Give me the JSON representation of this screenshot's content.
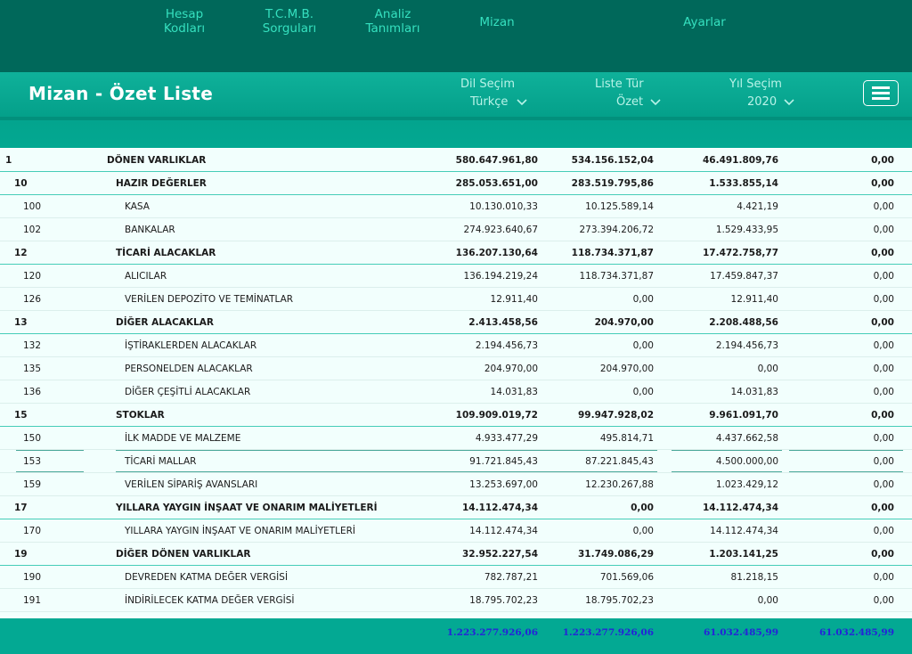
{
  "nav": {
    "items": [
      {
        "line1": "Hesap",
        "line2": "Kodları"
      },
      {
        "line1": "T.C.M.B.",
        "line2": "Sorguları"
      },
      {
        "line1": "Analiz",
        "line2": "Tanımları"
      },
      {
        "line1": "Mizan",
        "line2": ""
      },
      {
        "line1": "Ayarlar",
        "line2": ""
      }
    ]
  },
  "header": {
    "title": "Mizan - Özet Liste",
    "selectors": [
      {
        "label": "Dil Seçim",
        "value": "Türkçe"
      },
      {
        "label": "Liste Tür",
        "value": "Özet"
      },
      {
        "label": "Yıl Seçim",
        "value": "2020"
      }
    ],
    "menu_icon": "hamburger-icon"
  },
  "colors": {
    "nav_bg": "#00685a",
    "header_bg": "#04a08a",
    "nav_text": "#35e0bf",
    "total_text": "#2424d8"
  },
  "rows": [
    {
      "code": "1",
      "name": "DÖNEN VARLIKLAR",
      "v1": "580.647.961,80",
      "v2": "534.156.152,04",
      "v3": "46.491.809,76",
      "v4": "0,00"
    },
    {
      "code": "10",
      "name": "HAZIR DEĞERLER",
      "v1": "285.053.651,00",
      "v2": "283.519.795,86",
      "v3": "1.533.855,14",
      "v4": "0,00"
    },
    {
      "code": "100",
      "name": "KASA",
      "v1": "10.130.010,33",
      "v2": "10.125.589,14",
      "v3": "4.421,19",
      "v4": "0,00"
    },
    {
      "code": "102",
      "name": "BANKALAR",
      "v1": "274.923.640,67",
      "v2": "273.394.206,72",
      "v3": "1.529.433,95",
      "v4": "0,00"
    },
    {
      "code": "12",
      "name": "TİCARİ ALACAKLAR",
      "v1": "136.207.130,64",
      "v2": "118.734.371,87",
      "v3": "17.472.758,77",
      "v4": "0,00"
    },
    {
      "code": "120",
      "name": "ALICILAR",
      "v1": "136.194.219,24",
      "v2": "118.734.371,87",
      "v3": "17.459.847,37",
      "v4": "0,00"
    },
    {
      "code": "126",
      "name": "VERİLEN DEPOZİTO VE TEMİNATLAR",
      "v1": "12.911,40",
      "v2": "0,00",
      "v3": "12.911,40",
      "v4": "0,00"
    },
    {
      "code": "13",
      "name": "DİĞER ALACAKLAR",
      "v1": "2.413.458,56",
      "v2": "204.970,00",
      "v3": "2.208.488,56",
      "v4": "0,00"
    },
    {
      "code": "132",
      "name": "İŞTİRAKLERDEN ALACAKLAR",
      "v1": "2.194.456,73",
      "v2": "0,00",
      "v3": "2.194.456,73",
      "v4": "0,00"
    },
    {
      "code": "135",
      "name": "PERSONELDEN ALACAKLAR",
      "v1": "204.970,00",
      "v2": "204.970,00",
      "v3": "0,00",
      "v4": "0,00"
    },
    {
      "code": "136",
      "name": "DİĞER ÇEŞİTLİ ALACAKLAR",
      "v1": "14.031,83",
      "v2": "0,00",
      "v3": "14.031,83",
      "v4": "0,00"
    },
    {
      "code": "15",
      "name": "STOKLAR",
      "v1": "109.909.019,72",
      "v2": "99.947.928,02",
      "v3": "9.961.091,70",
      "v4": "0,00"
    },
    {
      "code": "150",
      "name": "İLK MADDE VE MALZEME",
      "v1": "4.933.477,29",
      "v2": "495.814,71",
      "v3": "4.437.662,58",
      "v4": "0,00"
    },
    {
      "code": "153",
      "name": "TİCARİ MALLAR",
      "v1": "91.721.845,43",
      "v2": "87.221.845,43",
      "v3": "4.500.000,00",
      "v4": "0,00"
    },
    {
      "code": "159",
      "name": "VERİLEN SİPARİŞ AVANSLARI",
      "v1": "13.253.697,00",
      "v2": "12.230.267,88",
      "v3": "1.023.429,12",
      "v4": "0,00"
    },
    {
      "code": "17",
      "name": "YILLARA YAYGIN İNŞAAT VE ONARIM MALİYETLERİ",
      "v1": "14.112.474,34",
      "v2": "0,00",
      "v3": "14.112.474,34",
      "v4": "0,00"
    },
    {
      "code": "170",
      "name": "YILLARA YAYGIN İNŞAAT VE ONARIM MALİYETLERİ",
      "v1": "14.112.474,34",
      "v2": "0,00",
      "v3": "14.112.474,34",
      "v4": "0,00"
    },
    {
      "code": "19",
      "name": "DİĞER DÖNEN VARLIKLAR",
      "v1": "32.952.227,54",
      "v2": "31.749.086,29",
      "v3": "1.203.141,25",
      "v4": "0,00"
    },
    {
      "code": "190",
      "name": "DEVREDEN KATMA DEĞER VERGİSİ",
      "v1": "782.787,21",
      "v2": "701.569,06",
      "v3": "81.218,15",
      "v4": "0,00"
    },
    {
      "code": "191",
      "name": "İNDİRİLECEK KATMA DEĞER VERGİSİ",
      "v1": "18.795.702,23",
      "v2": "18.795.702,23",
      "v3": "0,00",
      "v4": "0,00"
    }
  ],
  "totals": {
    "v1": "1.223.277.926,06",
    "v2": "1.223.277.926,06",
    "v3": "61.032.485,99",
    "v4": "61.032.485,99"
  }
}
